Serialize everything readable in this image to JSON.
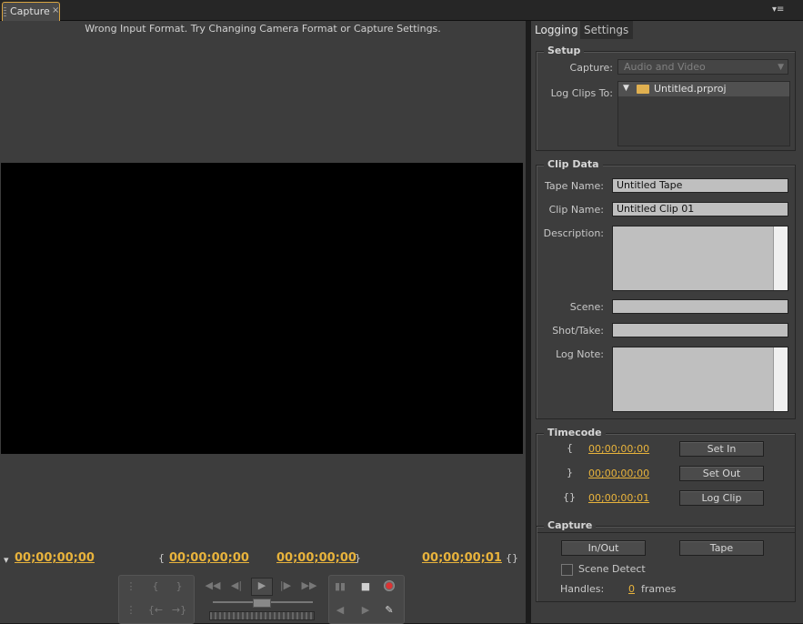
{
  "window": {
    "tab_title": "Capture",
    "tab_close": "×",
    "panel_menu": "▾≡"
  },
  "monitor": {
    "warning": "Wrong Input Format.  Try Changing Camera Format or Capture Settings.",
    "current_timecode": "00;00;00;00",
    "in_timecode": "00;00;00;00",
    "out_timecode": "00;00;00;00",
    "duration_timecode": "00;00;00;01"
  },
  "right_panel": {
    "tabs": [
      "Logging",
      "Settings"
    ],
    "setup": {
      "legend": "Setup",
      "capture_label": "Capture:",
      "capture_value": "Audio and Video",
      "log_clips_label": "Log Clips To:",
      "project_name": "Untitled.prproj"
    },
    "clip_data": {
      "legend": "Clip Data",
      "tape_name_label": "Tape Name:",
      "tape_name_value": "Untitled Tape",
      "clip_name_label": "Clip Name:",
      "clip_name_value": "Untitled Clip 01",
      "description_label": "Description:",
      "scene_label": "Scene:",
      "shot_take_label": "Shot/Take:",
      "log_note_label": "Log Note:"
    },
    "timecode": {
      "legend": "Timecode",
      "in_value": "00;00;00;00",
      "out_value": "00;00;00;00",
      "duration_value": "00;00;00;01",
      "set_in": "Set In",
      "set_out": "Set Out",
      "log_clip": "Log Clip"
    },
    "capture": {
      "legend": "Capture",
      "in_out": "In/Out",
      "tape": "Tape",
      "scene_detect": "Scene Detect",
      "handles_label": "Handles:",
      "handles_value": "0",
      "handles_unit": "frames"
    }
  }
}
